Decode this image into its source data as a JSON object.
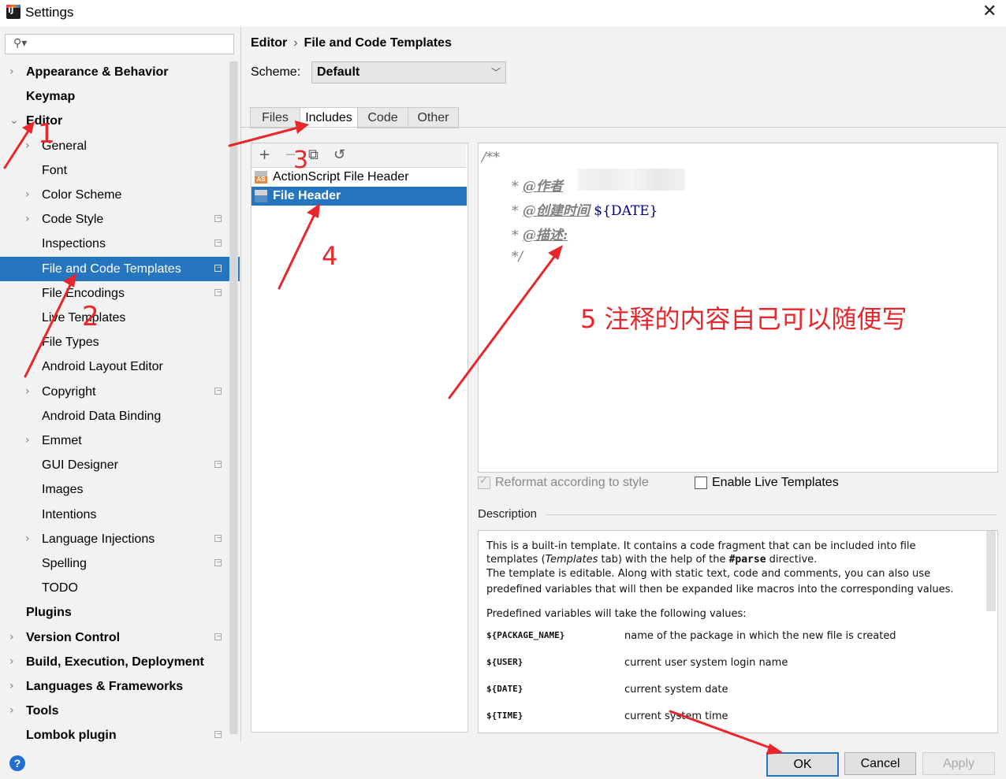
{
  "window": {
    "title": "Settings"
  },
  "search": {
    "placeholder": ""
  },
  "tree": [
    {
      "label": "Appearance & Behavior",
      "bold": true,
      "level": 0,
      "chevron": "right"
    },
    {
      "label": "Keymap",
      "bold": true,
      "level": 0,
      "chevron": ""
    },
    {
      "label": "Editor",
      "bold": true,
      "level": 0,
      "chevron": "down"
    },
    {
      "label": "General",
      "bold": false,
      "level": 1,
      "chevron": "right"
    },
    {
      "label": "Font",
      "bold": false,
      "level": 1,
      "chevron": ""
    },
    {
      "label": "Color Scheme",
      "bold": false,
      "level": 1,
      "chevron": "right"
    },
    {
      "label": "Code Style",
      "bold": false,
      "level": 1,
      "chevron": "right",
      "project": true
    },
    {
      "label": "Inspections",
      "bold": false,
      "level": 1,
      "chevron": "",
      "project": true
    },
    {
      "label": "File and Code Templates",
      "bold": false,
      "level": 1,
      "chevron": "",
      "project": true,
      "selected": true
    },
    {
      "label": "File Encodings",
      "bold": false,
      "level": 1,
      "chevron": "",
      "project": true
    },
    {
      "label": "Live Templates",
      "bold": false,
      "level": 1,
      "chevron": ""
    },
    {
      "label": "File Types",
      "bold": false,
      "level": 1,
      "chevron": ""
    },
    {
      "label": "Android Layout Editor",
      "bold": false,
      "level": 1,
      "chevron": ""
    },
    {
      "label": "Copyright",
      "bold": false,
      "level": 1,
      "chevron": "right",
      "project": true
    },
    {
      "label": "Android Data Binding",
      "bold": false,
      "level": 1,
      "chevron": ""
    },
    {
      "label": "Emmet",
      "bold": false,
      "level": 1,
      "chevron": "right"
    },
    {
      "label": "GUI Designer",
      "bold": false,
      "level": 1,
      "chevron": "",
      "project": true
    },
    {
      "label": "Images",
      "bold": false,
      "level": 1,
      "chevron": ""
    },
    {
      "label": "Intentions",
      "bold": false,
      "level": 1,
      "chevron": ""
    },
    {
      "label": "Language Injections",
      "bold": false,
      "level": 1,
      "chevron": "right",
      "project": true
    },
    {
      "label": "Spelling",
      "bold": false,
      "level": 1,
      "chevron": "",
      "project": true
    },
    {
      "label": "TODO",
      "bold": false,
      "level": 1,
      "chevron": ""
    },
    {
      "label": "Plugins",
      "bold": true,
      "level": 0,
      "chevron": ""
    },
    {
      "label": "Version Control",
      "bold": true,
      "level": 0,
      "chevron": "right",
      "project": true
    },
    {
      "label": "Build, Execution, Deployment",
      "bold": true,
      "level": 0,
      "chevron": "right"
    },
    {
      "label": "Languages & Frameworks",
      "bold": true,
      "level": 0,
      "chevron": "right"
    },
    {
      "label": "Tools",
      "bold": true,
      "level": 0,
      "chevron": "right"
    },
    {
      "label": "Lombok plugin",
      "bold": true,
      "level": 0,
      "chevron": "",
      "project": true
    }
  ],
  "breadcrumb": {
    "parent": "Editor",
    "separator": "›",
    "current": "File and Code Templates"
  },
  "scheme": {
    "label": "Scheme:",
    "value": "Default"
  },
  "tabs": [
    {
      "label": "Files",
      "active": false
    },
    {
      "label": "Includes",
      "active": true
    },
    {
      "label": "Code",
      "active": false
    },
    {
      "label": "Other",
      "active": false
    }
  ],
  "list_toolbar": {
    "add": "+",
    "remove": "−",
    "copy": "⧉",
    "reset": "↺"
  },
  "templates": [
    {
      "label": "ActionScript File Header",
      "icon": "actionscript-icon",
      "selected": false
    },
    {
      "label": "File Header",
      "icon": "file-header-icon",
      "selected": true
    }
  ],
  "editor": {
    "line1": "/**",
    "line2_star": "* ",
    "line2_tag": "@作者",
    "line3_star": "* ",
    "line3_tag": "@创建时间",
    "line3_var": " ${DATE}",
    "line4_star": "* ",
    "line4_tag": "@描述:",
    "line5": "*/"
  },
  "options": {
    "reformat": "Reformat according to style",
    "reformat_checked": true,
    "live_templates": "Enable Live Templates",
    "live_templates_checked": false
  },
  "description": {
    "label": "Description",
    "p1a": "This is a built-in template. It contains a code fragment that can be included into file",
    "p1b_pre": "templates (",
    "p1b_em": "Templates",
    "p1b_mid": " tab) with the help of the ",
    "p1b_code": "#parse",
    "p1b_post": " directive.",
    "p2a": "The template is editable. Along with static text, code and comments, you can also use",
    "p2b": "predefined variables that will then be expanded like macros into the corresponding values.",
    "p3": "Predefined variables will take the following values:",
    "variables": [
      {
        "name": "${PACKAGE_NAME}",
        "desc": "name of the package in which the new file is created"
      },
      {
        "name": "${USER}",
        "desc": "current user system login name"
      },
      {
        "name": "${DATE}",
        "desc": "current system date"
      },
      {
        "name": "${TIME}",
        "desc": "current system time"
      }
    ]
  },
  "buttons": {
    "ok": "OK",
    "cancel": "Cancel",
    "apply": "Apply",
    "help": "?"
  },
  "annotations": {
    "n1": "1",
    "n2": "2",
    "n3": "3",
    "n4": "4",
    "n5": "5 注释的内容自己可以随便写"
  },
  "colors": {
    "selection": "#2675bf",
    "annotation": "#e8262b",
    "template_var": "#00007f"
  }
}
